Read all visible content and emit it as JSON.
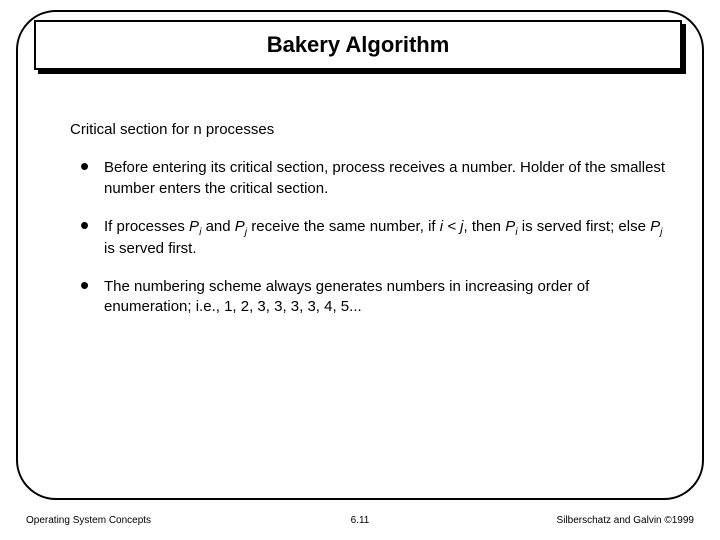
{
  "title": "Bakery Algorithm",
  "section": "Critical section for n processes",
  "bullets": {
    "b1a": "Before entering its critical section, process receives a number. Holder of the smallest number enters the critical section.",
    "b2_pre": "If processes ",
    "b2_p": "P",
    "b2_i": "i",
    "b2_and": " and ",
    "b2_j": "j",
    "b2_mid": " receive the same number, if ",
    "b2_cond": "i < j",
    "b2_then": ", then ",
    "b2_served1": " is served first; else ",
    "b2_served2": " is served first.",
    "b3": "The numbering scheme always generates numbers in increasing order of enumeration; i.e., 1, 2, 3, 3, 3, 3, 4, 5..."
  },
  "footer": {
    "left": "Operating System Concepts",
    "center": "6.11",
    "right": "Silberschatz and Galvin ©1999"
  }
}
